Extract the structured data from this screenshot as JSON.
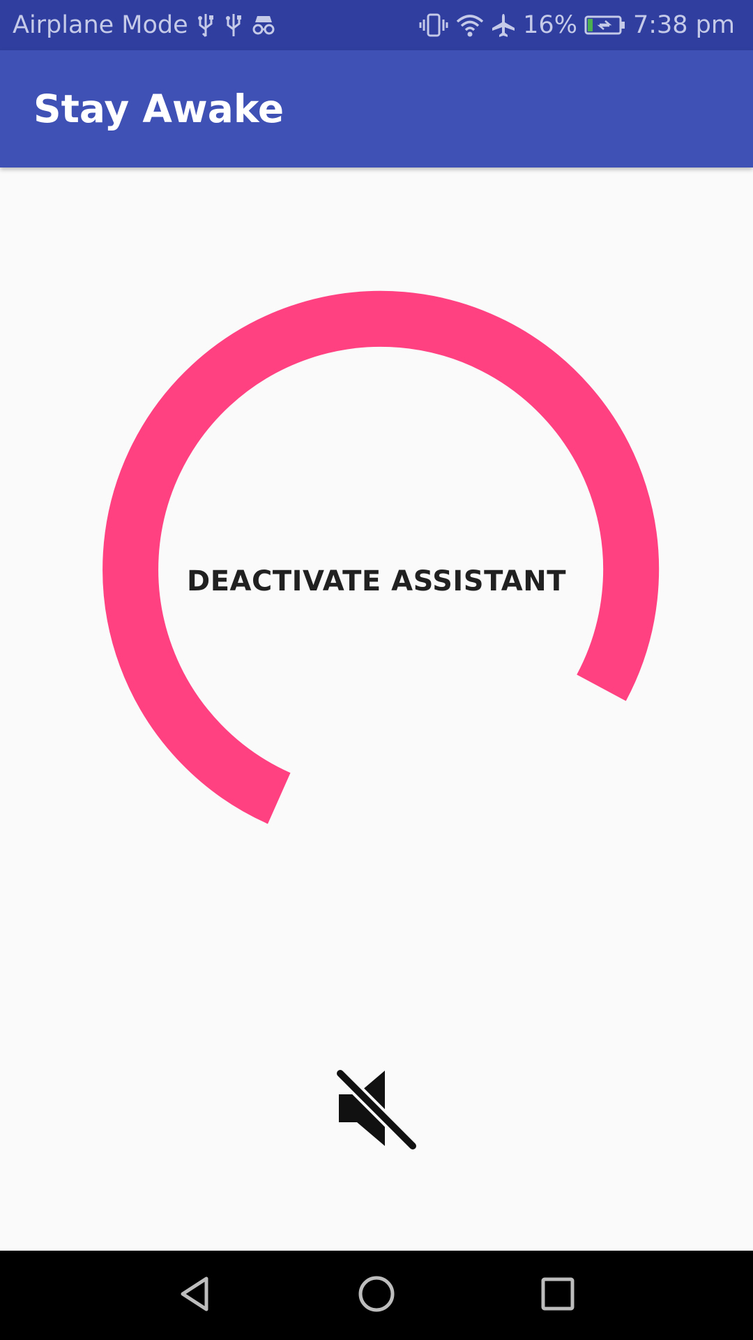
{
  "status_bar": {
    "mode_text": "Airplane Mode",
    "battery_percent": "16%",
    "time": "7:38 pm",
    "icons_left": [
      "usb-icon",
      "usb-icon",
      "incognito-icon"
    ],
    "icons_right": [
      "vibrate-icon",
      "wifi-icon",
      "airplane-icon",
      "battery-charging-icon"
    ],
    "battery_level": 0.16
  },
  "app_bar": {
    "title": "Stay Awake"
  },
  "main": {
    "assistant_button_label": "DEACTIVATE ASSISTANT",
    "mute_icon": "volume-off-icon"
  },
  "nav_bar": {
    "buttons": [
      "back-icon",
      "home-icon",
      "recents-icon"
    ]
  },
  "colors": {
    "status_bar": "#303f9f",
    "app_bar": "#3f51b5",
    "accent_ring": "#ff4081",
    "background": "#fafafa"
  }
}
